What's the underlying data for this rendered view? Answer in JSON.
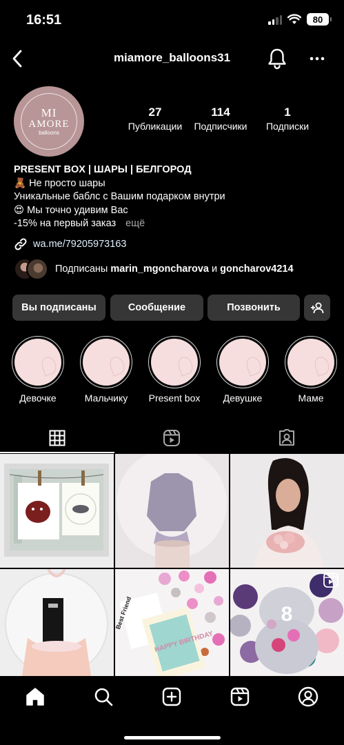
{
  "status_bar": {
    "time": "16:51",
    "battery": "80"
  },
  "header": {
    "username": "miamore_balloons31"
  },
  "avatar": {
    "line1": "MI",
    "line2": "AMORE",
    "line3": "balloons"
  },
  "stats": [
    {
      "value": "27",
      "label": "Публикации"
    },
    {
      "value": "114",
      "label": "Подписчики"
    },
    {
      "value": "1",
      "label": "Подписки"
    }
  ],
  "bio": {
    "name": "PRESENT BOX | ШАРЫ | БЕЛГОРОД",
    "line1": "🧸 Не просто шары",
    "line2": "Уникальные баблс с Вашим подарком внутри",
    "line3": "😍 Мы точно удивим Вас",
    "line4": "-15% на первый заказ",
    "more": "ещё"
  },
  "link": {
    "text": "wa.me/79205973163"
  },
  "followed_by": {
    "prefix": "Подписаны",
    "user1": "marin_mgoncharova",
    "conj": "и",
    "user2": "goncharov4214"
  },
  "buttons": {
    "following": "Вы подписаны",
    "message": "Сообщение",
    "call": "Позвонить"
  },
  "highlights": [
    {
      "label": "Девочке"
    },
    {
      "label": "Мальчику"
    },
    {
      "label": "Present box"
    },
    {
      "label": "Девушке"
    },
    {
      "label": "Маме"
    }
  ],
  "photo_overlays": {
    "card_text": "HAPPY BIRTHDAY",
    "card_small": "Best Friend",
    "balloon_number": "8"
  },
  "colors": {
    "background": "#000000",
    "button_bg": "#363636",
    "link": "#e0f1ff",
    "muted": "#a8a8a8",
    "avatar_bg": "#b89596",
    "highlight_bg": "#f6dede"
  }
}
